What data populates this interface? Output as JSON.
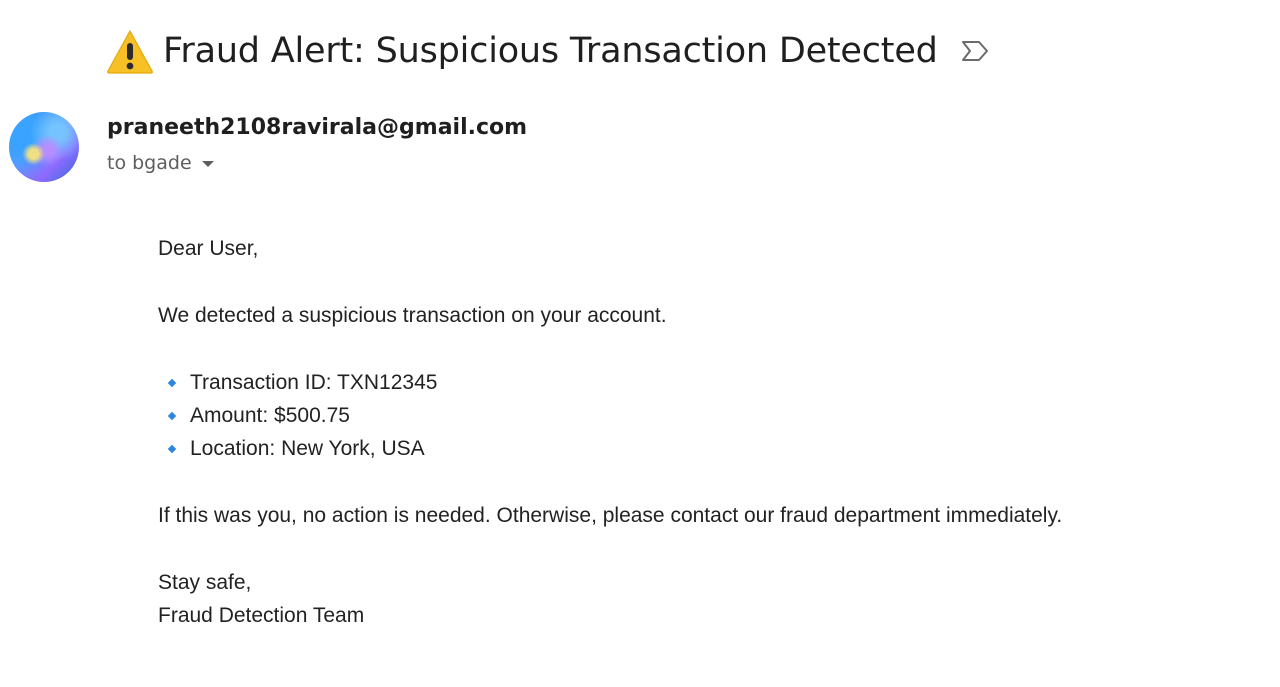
{
  "email": {
    "subject": "Fraud Alert: Suspicious Transaction Detected",
    "subject_icon": "warning-icon",
    "label_icon": "importance-marker-icon",
    "sender": "praneeth2108ravirala@gmail.com",
    "recipient_line": "to bgade",
    "avatar_icon": "sender-avatar"
  },
  "body": {
    "greeting": "Dear User,",
    "intro": "We detected a suspicious transaction on your account.",
    "details": [
      "Transaction ID: TXN12345",
      "Amount: $500.75",
      "Location: New York, USA"
    ],
    "action": "If this was you, no action is needed. Otherwise, please contact our fraud department immediately.",
    "signoff": "Stay safe,",
    "signature": "Fraud Detection Team"
  },
  "colors": {
    "bullet": "#2e86de",
    "warning_fill": "#f6c026",
    "text_primary": "#1f1f1f",
    "text_secondary": "#5e5e5e"
  }
}
